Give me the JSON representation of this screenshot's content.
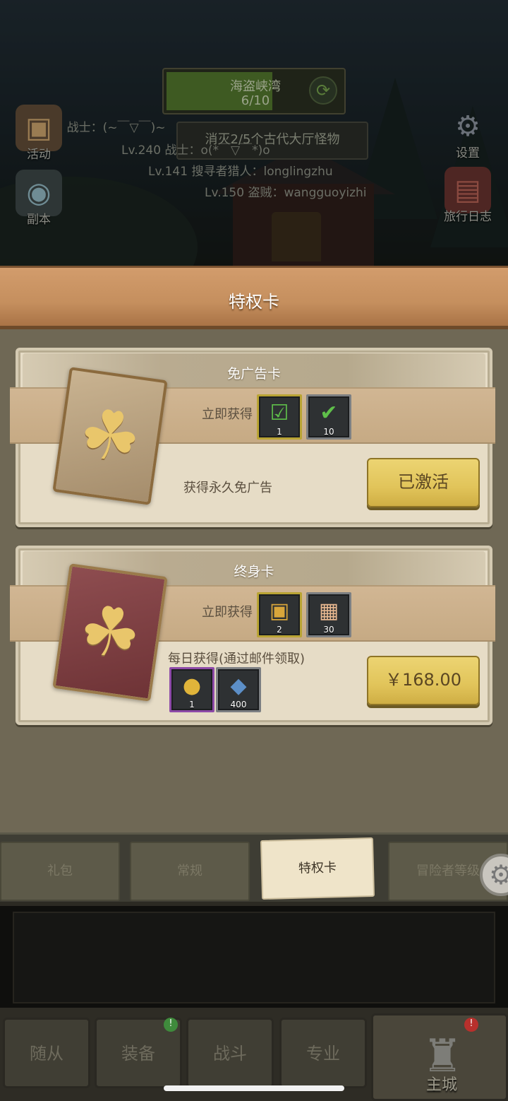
{
  "top": {
    "quest": {
      "name": "海盗峡湾",
      "progress": "6/10"
    },
    "sub_quest": "消灭2/5个古代大厅怪物",
    "chat": [
      "Lv.42 战士：(~￣▽￣)~",
      "Lv.240 战士：o(*￣▽￣*)o",
      "Lv.141 搜寻者猎人：longlingzhu",
      "Lv.150 盗贼：wangguoyizhi"
    ],
    "side_buttons": {
      "activity": "活动",
      "dungeon": "副本",
      "settings": "设置",
      "journal": "旅行日志"
    }
  },
  "header": {
    "title": "特权卡"
  },
  "cards": [
    {
      "title": "免广告卡",
      "instant_label": "立即获得",
      "instant_items": [
        {
          "icon": "chest-check-icon",
          "qty": "1"
        },
        {
          "icon": "ticket-check-icon",
          "qty": "10"
        }
      ],
      "description": "获得永久免广告",
      "button": "已激活"
    },
    {
      "title": "终身卡",
      "instant_label": "立即获得",
      "instant_items": [
        {
          "icon": "gold-chest-icon",
          "qty": "2"
        },
        {
          "icon": "scroll-icon",
          "qty": "30"
        }
      ],
      "daily_label": "每日获得(通过邮件领取)",
      "daily_items": [
        {
          "icon": "gold-coins-icon",
          "qty": "1"
        },
        {
          "icon": "blue-gem-icon",
          "qty": "400"
        }
      ],
      "button": "￥168.00"
    }
  ],
  "tabs": [
    "礼包",
    "常规",
    "特权卡",
    "冒险者等级"
  ],
  "nav": {
    "items": [
      "随从",
      "装备",
      "战斗",
      "专业"
    ],
    "home": "主城"
  },
  "colors": {
    "accent_yellow": "#e1c45a",
    "panel": "#6f6855",
    "plank": "#c58f5e"
  }
}
